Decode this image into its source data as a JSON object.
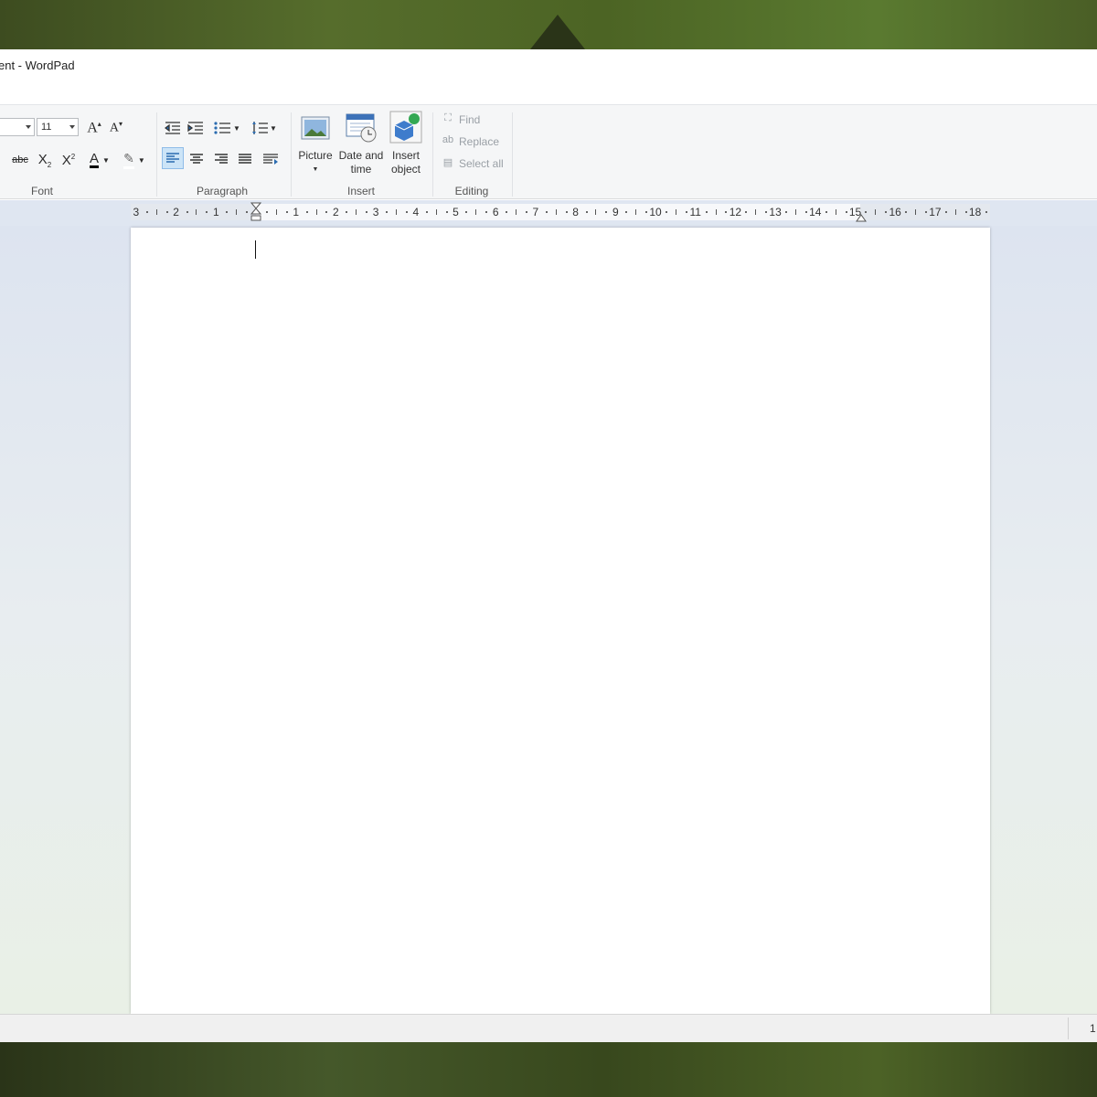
{
  "window": {
    "title": "ent - WordPad"
  },
  "font_group": {
    "label": "Font",
    "font_size": "11",
    "buttons": [
      "grow-font",
      "shrink-font",
      "strikethrough",
      "subscript",
      "superscript",
      "text-color",
      "highlight"
    ]
  },
  "paragraph_group": {
    "label": "Paragraph"
  },
  "insert_group": {
    "label": "Insert",
    "picture": "Picture",
    "datetime_line1": "Date and",
    "datetime_line2": "time",
    "object_line1": "Insert",
    "object_line2": "object"
  },
  "editing_group": {
    "label": "Editing",
    "find": "Find",
    "replace": "Replace",
    "select_all": "Select all"
  },
  "ruler": {
    "labels": [
      "3",
      "2",
      "1",
      "1",
      "2",
      "3",
      "4",
      "5",
      "6",
      "7",
      "8",
      "9",
      "10",
      "11",
      "12",
      "13",
      "14",
      "15",
      "16",
      "17",
      "18"
    ]
  },
  "statusbar": {
    "zoom": "1"
  },
  "colors": {
    "accent": "#cce4f7",
    "ribbon": "#f5f6f7",
    "page_bg": "#dde4f0"
  }
}
